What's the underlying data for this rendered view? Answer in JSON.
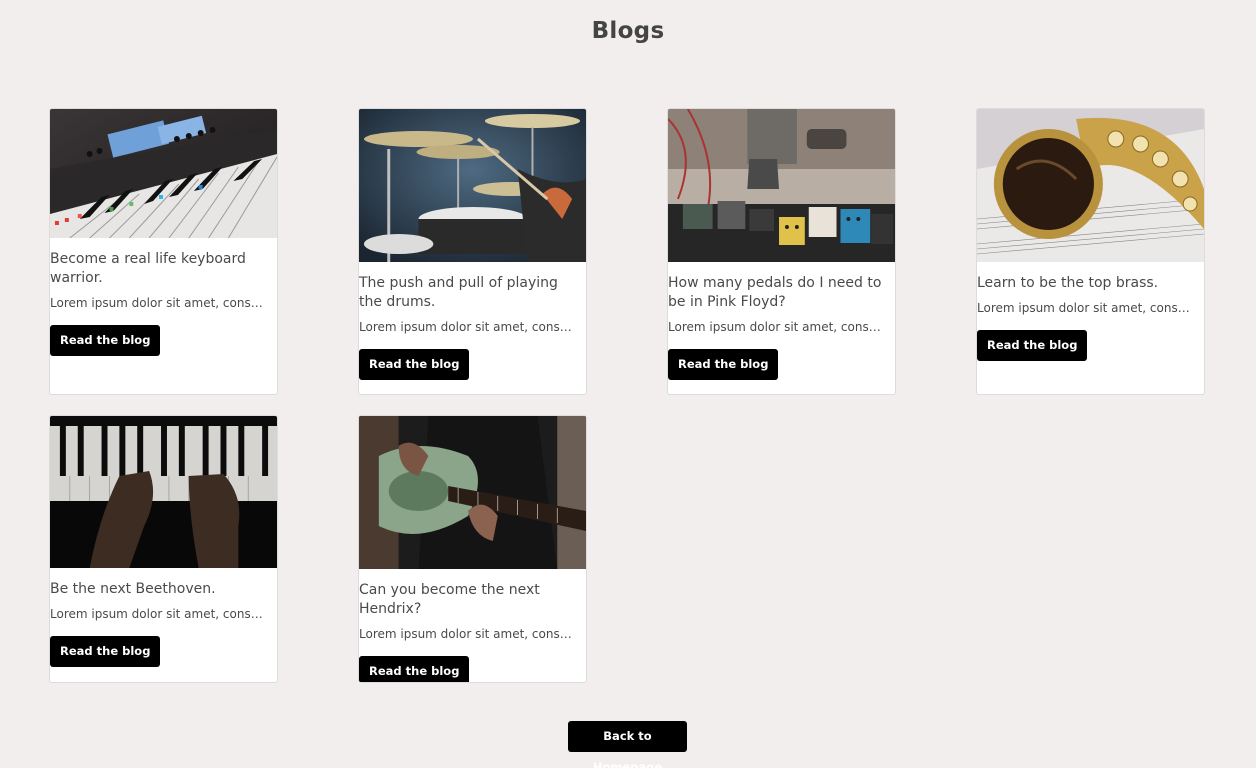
{
  "page": {
    "title": "Blogs"
  },
  "cards": [
    {
      "title": "Become a real life keyboard warrior.",
      "excerpt": "Lorem ipsum dolor sit amet, consectetur adipiscing elit.",
      "button": "Read the blog",
      "image": "synthesizer-keyboard-image"
    },
    {
      "title": "The push and pull of playing the drums.",
      "excerpt": "Lorem ipsum dolor sit amet, consectetur adipiscing elit.",
      "button": "Read the blog",
      "image": "drum-kit-image"
    },
    {
      "title": "How many pedals do I need to be in Pink Floyd?",
      "excerpt": "Lorem ipsum dolor sit amet, consectetur adipiscing elit.",
      "button": "Read the blog",
      "image": "guitar-pedals-image"
    },
    {
      "title": "Learn to be the top brass.",
      "excerpt": "Lorem ipsum dolor sit amet, consectetur adipiscing elit.",
      "button": "Read the blog",
      "image": "saxophone-image"
    },
    {
      "title": "Be the next Beethoven.",
      "excerpt": "Lorem ipsum dolor sit amet, consectetur adipiscing elit.",
      "button": "Read the blog",
      "image": "piano-hands-image"
    },
    {
      "title": "Can you become the next Hendrix?",
      "excerpt": "Lorem ipsum dolor sit amet, consectetur adipiscing elit.",
      "button": "Read the blog",
      "image": "electric-guitar-image"
    }
  ],
  "footer": {
    "back_label": "Back to Homepage"
  },
  "colors": {
    "background": "#f1eeed",
    "button": "#000000",
    "card": "#ffffff"
  }
}
